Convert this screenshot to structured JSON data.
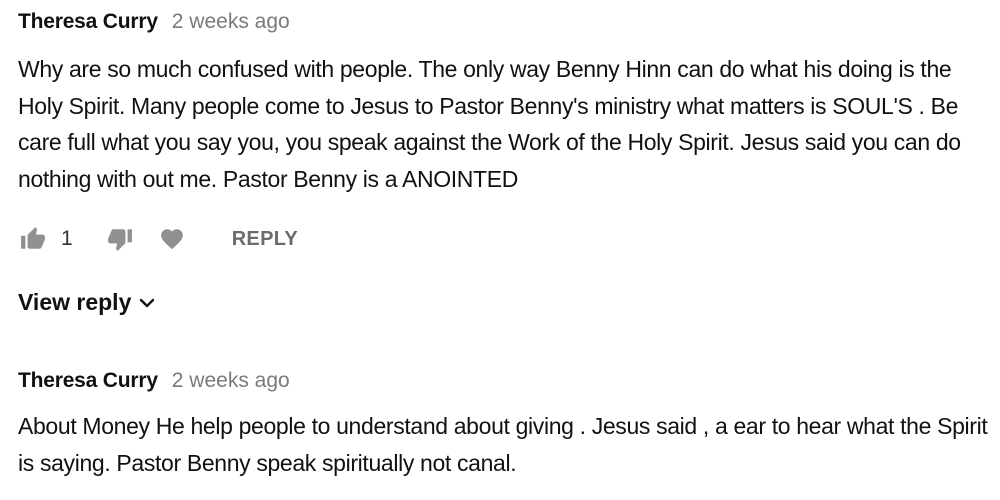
{
  "comments": [
    {
      "author": "Theresa Curry",
      "time": "2 weeks ago",
      "text": "Why are so much confused with people. The only way Benny Hinn can do what his doing is the Holy Spirit. Many people come to Jesus to Pastor Benny's ministry what matters is SOUL'S . Be care full what you say you, you speak against the Work of the Holy Spirit. Jesus said you can do nothing with out me. Pastor Benny is a ANOINTED",
      "likes": "1",
      "reply_label": "REPLY",
      "view_reply_label": "View reply"
    },
    {
      "author": "Theresa Curry",
      "time": "2 weeks ago",
      "text": "About Money He help people to understand about giving . Jesus said , a ear to hear what the Spirit is saying. Pastor Benny speak spiritually not canal."
    }
  ],
  "icons": {
    "like": "thumbs-up-icon",
    "dislike": "thumbs-down-icon",
    "heart": "heart-icon",
    "expand": "chevron-down-icon"
  },
  "colors": {
    "text": "#111111",
    "muted": "#7a7a7a",
    "icon": "#909090",
    "reply": "#6b6b6b"
  }
}
